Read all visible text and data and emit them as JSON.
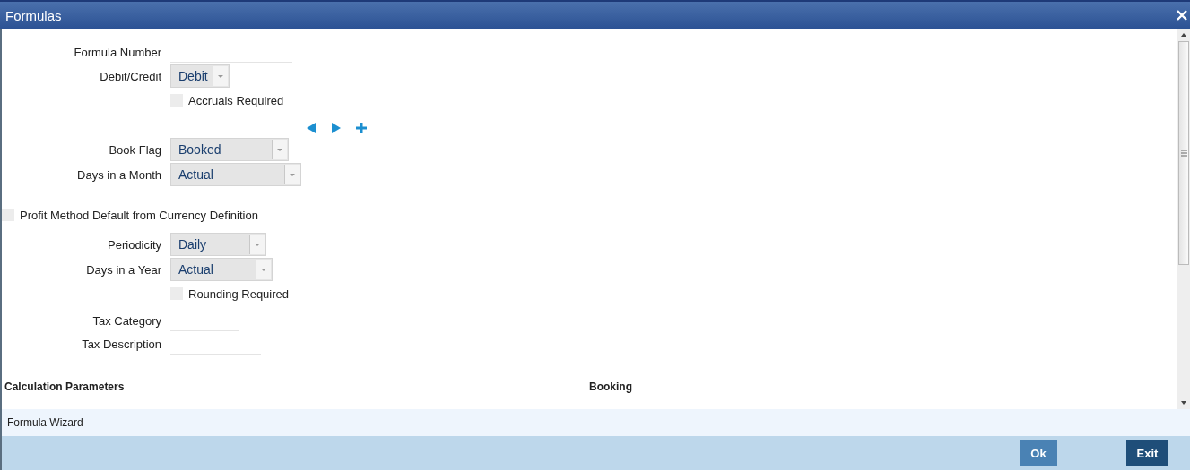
{
  "window": {
    "title": "Formulas"
  },
  "groups": [
    [
      {
        "kind": "text",
        "label": "Formula Number"
      },
      {
        "kind": "select",
        "label": "Debit/Credit",
        "value": "Debit"
      },
      {
        "kind": "checkbox",
        "label": "Accruals Required",
        "checked": false
      }
    ],
    [
      {
        "kind": "nav"
      }
    ],
    [
      {
        "kind": "select",
        "label": "Book Flag",
        "value": "Booked"
      },
      {
        "kind": "select",
        "label": "Days in a Month",
        "value": "Actual"
      }
    ],
    [
      {
        "kind": "wide_checkbox",
        "label": "Profit Method Default from Currency Definition",
        "checked": false
      }
    ],
    [
      {
        "kind": "select",
        "label": "Periodicity",
        "value": "Daily"
      },
      {
        "kind": "select",
        "label": "Days in a Year",
        "value": "Actual"
      },
      {
        "kind": "checkbox",
        "label": "Rounding Required",
        "checked": false
      }
    ],
    [
      {
        "kind": "text",
        "label": "Tax Category"
      },
      {
        "kind": "text",
        "label": "Tax Description"
      }
    ]
  ],
  "sections": [
    "Calculation Parameters",
    "Booking"
  ],
  "footer": {
    "link": "Formula Wizard"
  },
  "buttons": [
    {
      "label": "Ok",
      "kind": "secondary"
    },
    {
      "label": "Exit",
      "kind": "primary"
    }
  ]
}
